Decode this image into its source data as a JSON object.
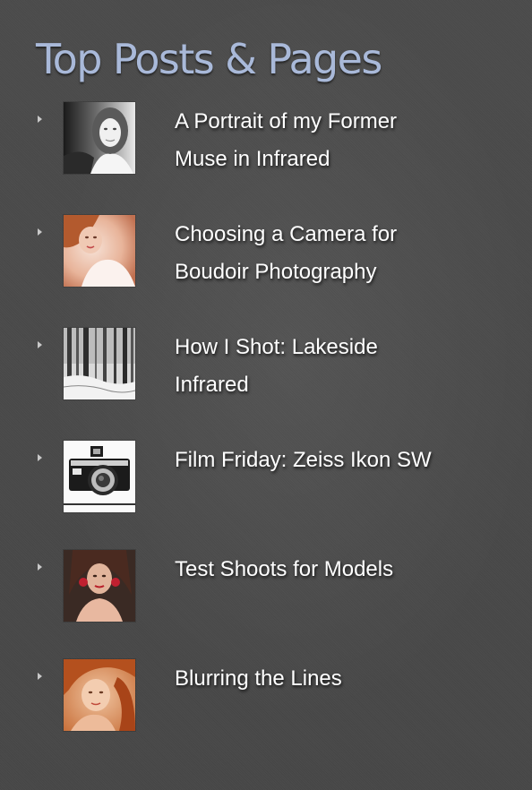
{
  "widget": {
    "title": "Top Posts & Pages"
  },
  "posts": [
    {
      "title_line1": "A Portrait of my Former",
      "title_line2": "Muse in Infrared",
      "thumb_icon": "portrait-infrared-thumbnail"
    },
    {
      "title_line1": "Choosing a Camera for",
      "title_line2": "Boudoir Photography",
      "thumb_icon": "boudoir-portrait-thumbnail"
    },
    {
      "title_line1": "How I Shot: Lakeside",
      "title_line2": "Infrared",
      "thumb_icon": "lakeside-trees-thumbnail"
    },
    {
      "title_line1": "Film Friday: Zeiss Ikon SW",
      "title_line2": "",
      "thumb_icon": "film-camera-thumbnail"
    },
    {
      "title_line1": "Test Shoots for Models",
      "title_line2": "",
      "thumb_icon": "model-portrait-thumbnail"
    },
    {
      "title_line1": "Blurring the Lines",
      "title_line2": "",
      "thumb_icon": "redhead-portrait-thumbnail"
    }
  ],
  "colors": {
    "background": "#4a4a4a",
    "title": "#a9b9d9",
    "link": "#ffffff",
    "bullet": "#c9c9c9"
  }
}
